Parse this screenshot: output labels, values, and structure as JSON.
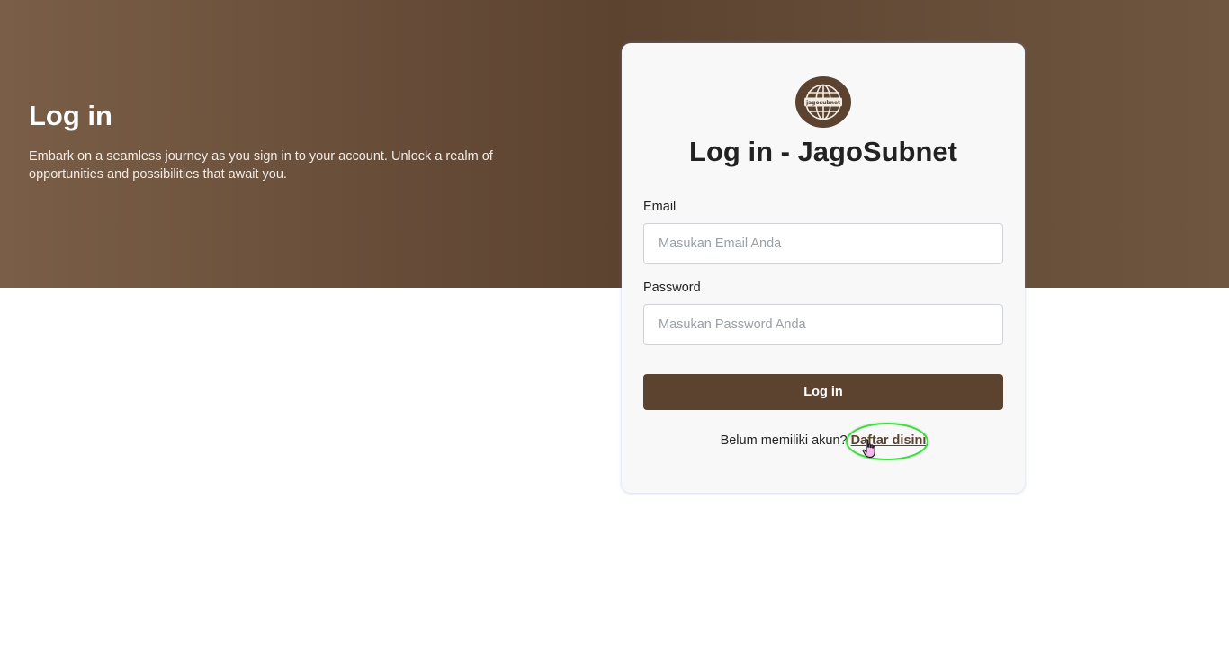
{
  "hero": {
    "title": "Log in",
    "description": "Embark on a seamless journey as you sign in to your account. Unlock a realm of opportunities and possibilities that await you."
  },
  "card": {
    "logo_text": "jagosubnet",
    "title": "Log in - JagoSubnet",
    "email": {
      "label": "Email",
      "placeholder": "Masukan Email Anda",
      "value": ""
    },
    "password": {
      "label": "Password",
      "placeholder": "Masukan Password Anda",
      "value": ""
    },
    "submit_label": "Log in",
    "register_prompt": "Belum memiliki akun?",
    "register_link": "Daftar disini"
  },
  "colors": {
    "brand": "#5c4330",
    "highlight": "#3ddc3d"
  },
  "icons": {
    "logo": "globe-icon",
    "cursor": "hand-pointer-icon"
  }
}
